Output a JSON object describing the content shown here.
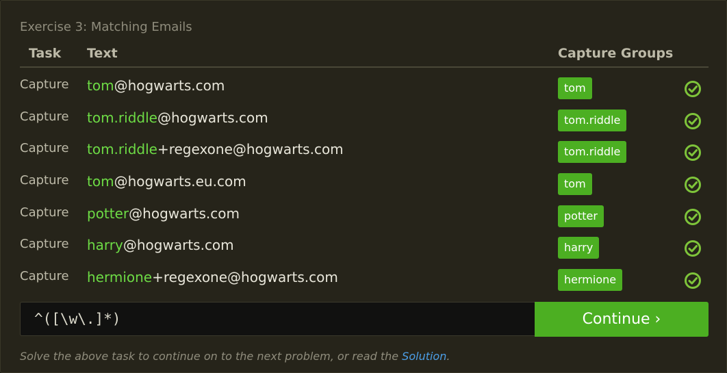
{
  "exercise_title": "Exercise 3: Matching Emails",
  "columns": {
    "task": "Task",
    "text": "Text",
    "groups": "Capture Groups"
  },
  "rows": [
    {
      "task": "Capture",
      "match": "tom",
      "rest": "@hogwarts.com",
      "group": "tom",
      "status_icon": "check-circle-icon"
    },
    {
      "task": "Capture",
      "match": "tom.riddle",
      "rest": "@hogwarts.com",
      "group": "tom.riddle",
      "status_icon": "check-circle-icon"
    },
    {
      "task": "Capture",
      "match": "tom.riddle",
      "rest": "+regexone@hogwarts.com",
      "group": "tom.riddle",
      "status_icon": "check-circle-icon"
    },
    {
      "task": "Capture",
      "match": "tom",
      "rest": "@hogwarts.eu.com",
      "group": "tom",
      "status_icon": "check-circle-icon"
    },
    {
      "task": "Capture",
      "match": "potter",
      "rest": "@hogwarts.com",
      "group": "potter",
      "status_icon": "check-circle-icon"
    },
    {
      "task": "Capture",
      "match": "harry",
      "rest": "@hogwarts.com",
      "group": "harry",
      "status_icon": "check-circle-icon"
    },
    {
      "task": "Capture",
      "match": "hermione",
      "rest": "+regexone@hogwarts.com",
      "group": "hermione",
      "status_icon": "check-circle-icon"
    }
  ],
  "input": {
    "value": "^([\\w\\.]*)"
  },
  "continue_label": "Continue ›",
  "footer": {
    "before": "Solve the above task to continue on to the next problem, or read the ",
    "link": "Solution",
    "after": "."
  },
  "colors": {
    "match": "#6ddb45",
    "badge": "#4caf22",
    "check": "#7ec43a",
    "link": "#4c9ee6"
  }
}
